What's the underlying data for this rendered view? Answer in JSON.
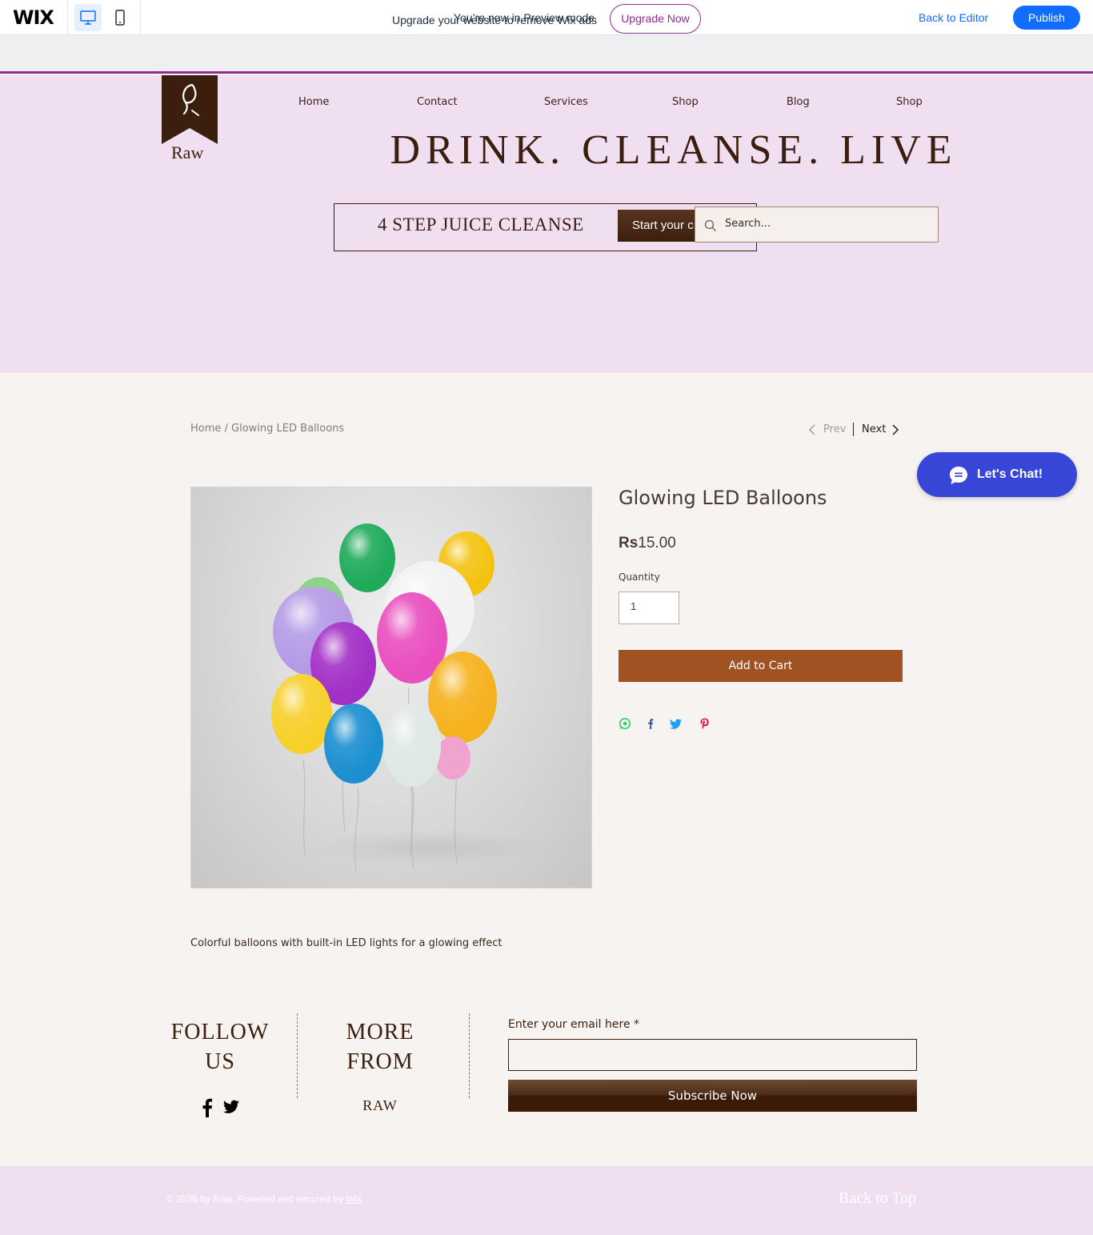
{
  "wix_bar": {
    "logo": "WIX",
    "device_desktop_icon": "desktop-icon",
    "device_mobile_icon": "mobile-icon",
    "preview_message": "You’re now in Preview mode",
    "back_to_editor": "Back to Editor",
    "publish": "Publish",
    "accent_color": "#116dff"
  },
  "upgrade_banner": {
    "text": "Upgrade your website to remove Wix ads",
    "button": "Upgrade Now",
    "color": "#932b8e"
  },
  "header": {
    "logo_text": "Raw",
    "logo_icon": "leaf-ribbon-icon",
    "nav": [
      "Home",
      "Contact",
      "Services",
      "Shop",
      "Blog",
      "Shop"
    ],
    "headline": "DRINK. CLEANSE. LIVE",
    "hero_title": "4 STEP JUICE CLEANSE",
    "hero_button": "Start your c",
    "search_placeholder": "Search...",
    "background": "#efdff1"
  },
  "product": {
    "breadcrumb_home": "Home",
    "breadcrumb_sep": " / ",
    "breadcrumb_current": "Glowing LED Balloons",
    "prev": "Prev",
    "next": "Next",
    "title": "Glowing LED Balloons",
    "currency": "Rs",
    "price": "15.00",
    "quantity_label": "Quantity",
    "quantity_value": "1",
    "add_to_cart": "Add to Cart",
    "share_icons": [
      "whatsapp-icon",
      "facebook-icon",
      "twitter-icon",
      "pinterest-icon"
    ],
    "description": "Colorful balloons with built-in LED lights for a glowing effect",
    "button_color": "#a05223"
  },
  "chat": {
    "label": "Let's Chat!",
    "icon": "chat-bubble-icon",
    "color": "#3746d6"
  },
  "footer": {
    "follow_line1": "FOLLOW",
    "follow_line2": "US",
    "more_line1": "MORE",
    "more_line2": "FROM",
    "more_link": "RAW",
    "email_label": "Enter your email here *",
    "subscribe": "Subscribe Now",
    "copyright_text": "© 2035 by Raw. Powered and secured by ",
    "copyright_link": "Wix",
    "back_to_top": "Back to Top"
  }
}
